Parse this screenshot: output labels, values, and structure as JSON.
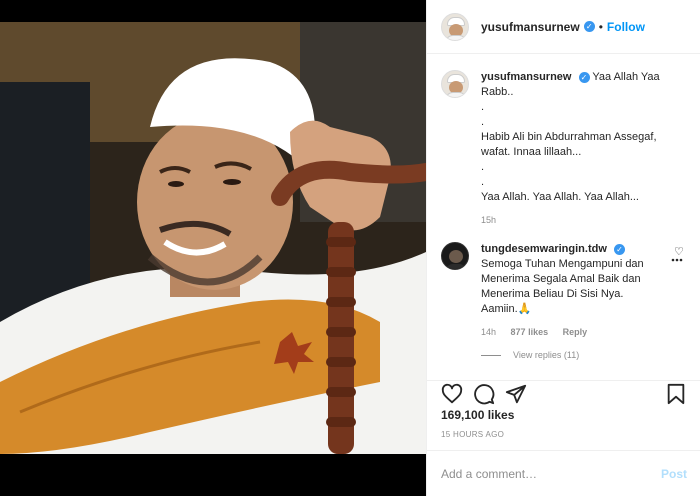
{
  "post": {
    "username": "yusufmansurnew",
    "follow_label": "Follow",
    "separator": "•"
  },
  "caption": {
    "username": "yusufmansurnew",
    "lines": [
      "Yaa Allah Yaa",
      "Rabb..",
      ".",
      ".",
      "Habib Ali bin Abdurrahman Assegaf,",
      "wafat. Innaa lillaah...",
      ".",
      ".",
      "Yaa Allah. Yaa Allah. Yaa Allah..."
    ],
    "age": "15h"
  },
  "comment": {
    "username": "tungdesemwaringin.tdw",
    "lines": [
      "Semoga Tuhan Mengampuni dan",
      "Menerima Segala Amal Baik dan",
      "Menerima Beliau Di Sisi Nya.",
      "Aamiin.🙏"
    ],
    "age": "14h",
    "likes": "877 likes",
    "reply_label": "Reply",
    "view_replies": "View replies (11)"
  },
  "stats": {
    "likes": "169,100 likes",
    "timestamp": "15 HOURS AGO"
  },
  "compose": {
    "placeholder": "Add a comment…",
    "post_label": "Post"
  },
  "icons": {
    "heart": "heart-icon",
    "comment": "comment-icon",
    "share": "share-icon",
    "save": "bookmark-icon",
    "more": "more-icon",
    "verified": "verified-badge-icon"
  },
  "colors": {
    "link_blue": "#0095f6",
    "verified_blue": "#3897f0",
    "muted_gray": "#8e8e8e",
    "post_disabled": "#b2dffc"
  }
}
